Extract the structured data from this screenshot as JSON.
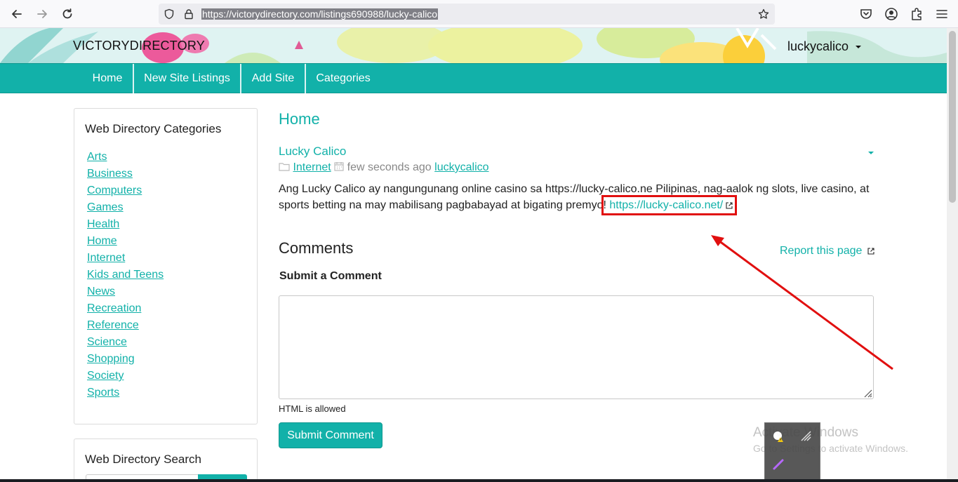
{
  "browser": {
    "url": "https://victorydirectory.com/listings690988/lucky-calico",
    "icons": [
      "back-arrow-icon",
      "forward-arrow-icon",
      "reload-icon",
      "shield-icon",
      "lock-icon",
      "star-icon",
      "pocket-icon",
      "account-icon",
      "extensions-icon",
      "menu-icon"
    ]
  },
  "header": {
    "brand": "VICTORYDIRECTORY",
    "username": "luckycalico"
  },
  "nav": {
    "items": [
      "Home",
      "New Site Listings",
      "Add Site",
      "Categories"
    ]
  },
  "sidebar": {
    "categories_title": "Web Directory Categories",
    "categories": [
      "Arts",
      "Business",
      "Computers",
      "Games",
      "Health",
      "Home",
      "Internet",
      "Kids and Teens",
      "News",
      "Recreation",
      "Reference",
      "Science",
      "Shopping",
      "Society",
      "Sports"
    ],
    "search_title": "Web Directory Search"
  },
  "main": {
    "page_title": "Home",
    "listing": {
      "title": "Lucky Calico",
      "category": "Internet",
      "time": "few seconds ago",
      "author": "luckycalico",
      "description": "Ang Lucky Calico ay nangungunang online casino sa https://lucky-calico.ne Pilipinas, nag-aalok ng slots, live casino, at sports betting na may mabilisang pagbabayad at bigating premyo!",
      "link": "https://lucky-calico.net/"
    },
    "comments": {
      "heading": "Comments",
      "report": "Report this page",
      "submit_heading": "Submit a Comment",
      "textarea_value": "",
      "html_note": "HTML is allowed",
      "submit_button": "Submit Comment"
    }
  },
  "overlay": {
    "activate_title": "Activate Windows",
    "activate_sub": "Go to Settings to activate Windows.",
    "annotation_color": "#e10f0f"
  },
  "colors": {
    "accent": "#12b1a9",
    "annotation": "#e10f0f"
  }
}
